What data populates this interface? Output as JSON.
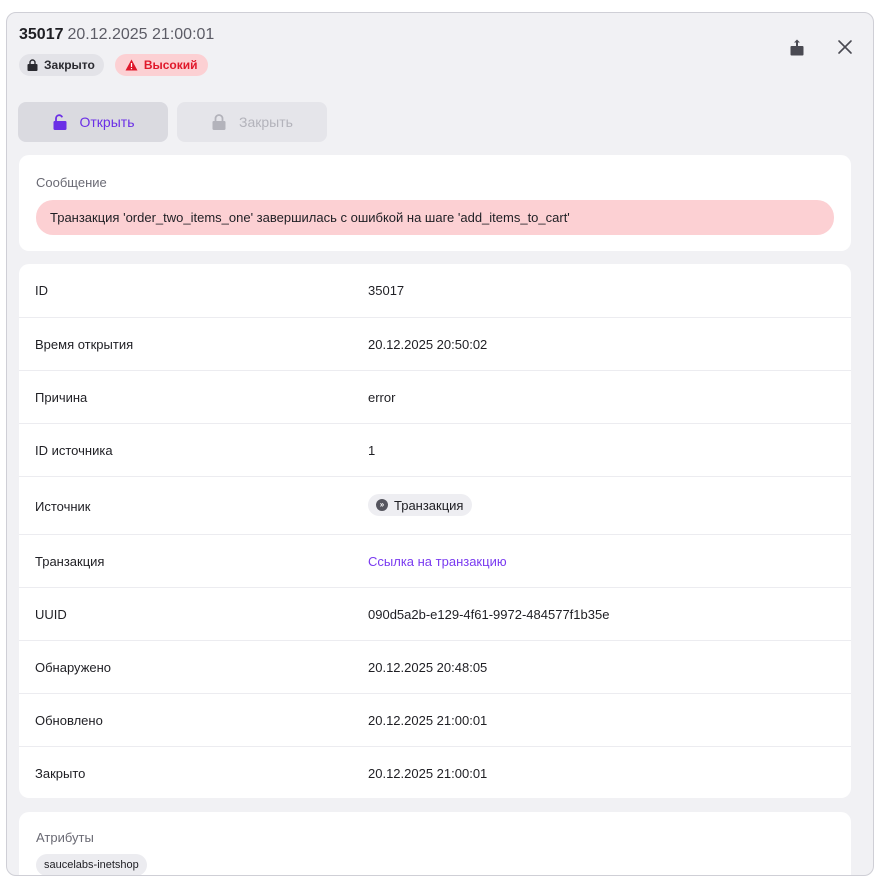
{
  "header": {
    "incident_id": "35017",
    "datetime": "20.12.2025 21:00:01",
    "status_chip": "Закрыто",
    "priority_chip": "Высокий"
  },
  "actions": {
    "open_label": "Открыть",
    "close_label": "Закрыть"
  },
  "message": {
    "label": "Сообщение",
    "text": "Транзакция 'order_two_items_one' завершилась с ошибкой на шаге 'add_items_to_cart'"
  },
  "properties": [
    {
      "label": "ID",
      "value": "35017"
    },
    {
      "label": "Время открытия",
      "value": "20.12.2025 20:50:02"
    },
    {
      "label": "Причина",
      "value": "error"
    },
    {
      "label": "ID источника",
      "value": "1"
    },
    {
      "label": "Источник",
      "value": "Транзакция"
    },
    {
      "label": "Транзакция",
      "value": "Ссылка на транзакцию"
    },
    {
      "label": "UUID",
      "value": "090d5a2b-e129-4f61-9972-484577f1b35e"
    },
    {
      "label": "Обнаружено",
      "value": "20.12.2025 20:48:05"
    },
    {
      "label": "Обновлено",
      "value": "20.12.2025 21:00:01"
    },
    {
      "label": "Закрыто",
      "value": "20.12.2025 21:00:01"
    }
  ],
  "attributes": {
    "label": "Атрибуты",
    "tags": [
      "saucelabs-inetshop"
    ]
  },
  "colors": {
    "accent": "#6b2fe6",
    "danger": "#e0182b",
    "danger_bg": "#fcd0d3",
    "link": "#7a3bf0"
  },
  "icons": {
    "status": "lock-closed-icon",
    "priority": "warning-triangle-icon",
    "share": "share-icon",
    "close": "close-icon",
    "open_action": "lock-open-icon",
    "close_action": "lock-closed-icon",
    "source": "transaction-icon"
  }
}
